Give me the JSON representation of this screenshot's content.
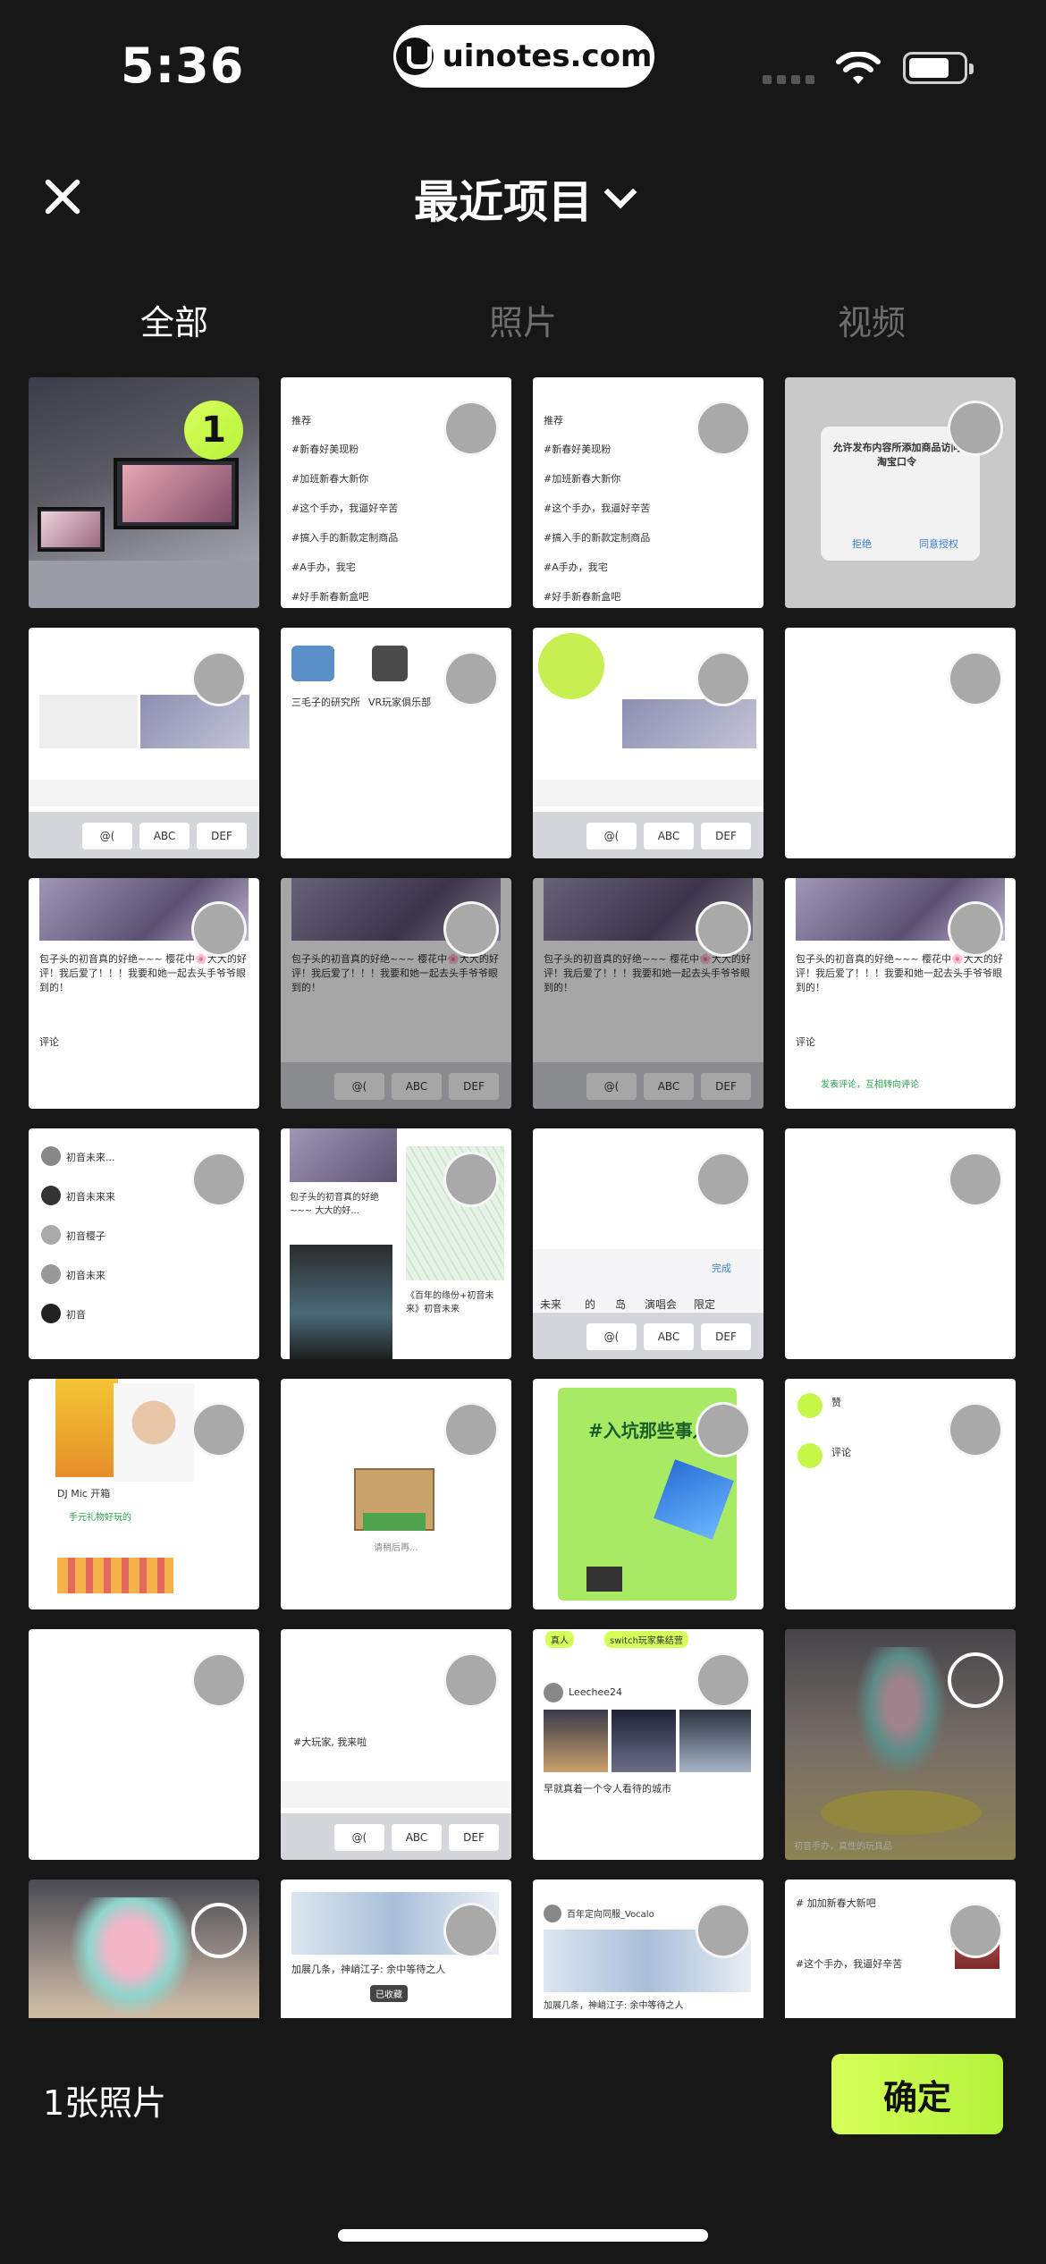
{
  "status_bar": {
    "time": "5:36",
    "url": "uinotes.com"
  },
  "header": {
    "title": "最近项目"
  },
  "tabs": [
    {
      "label": "全部",
      "active": true
    },
    {
      "label": "照片",
      "active": false
    },
    {
      "label": "视频",
      "active": false
    }
  ],
  "grid": {
    "selected_index": "1",
    "thumb_texts": {
      "t2_title": "推荐",
      "t2_lines": [
        "#新春好美现粉",
        "#加班新春大新你",
        "#这个手办，我逼好辛苦",
        "#搞入手的新款定制商品",
        "#A手办，我宅",
        "#好手新春新盒吧"
      ],
      "t4_dialog_title": "允许发布内容所添加商品访问淘宝口令",
      "t4_dialog_btn_left": "拒绝",
      "t4_dialog_btn_right": "同意授权",
      "t6_left": "三毛子的研究所",
      "t6_right": "VR玩家俱乐部",
      "kbd_keys": [
        "@(",
        "ABC",
        "DEF"
      ],
      "t9_caption": "包子头的初音真的好绝~~~ 樱花中🌸大大的好评！我后爱了！！！我要和她一起去头手爷爷眼到的！",
      "t12_comments": "评论",
      "t12_prompt": "发表评论，互相转向评论",
      "t13_users": [
        "初音未来...",
        "初音未来来",
        "初音樱子",
        "初音未来",
        "初音"
      ],
      "t14_caption": "包子头的初音真的好绝~~~ 大大的好...",
      "t14_sub": "《百年的缘份+初音未来》初音未来",
      "t15_suggest": [
        "未来",
        "的",
        "岛",
        "演唱会",
        "限定"
      ],
      "t15_done": "完成",
      "t17_title": "DJ Mic 开箱",
      "t17_tag": "手元礼物好玩的",
      "t18_label": "请稍后再...",
      "t19_title": "#入坑那些事儿",
      "t20_items": [
        "赞",
        "评论"
      ],
      "t22_label": "#大玩家, 我来啦",
      "t23_user": "Leechee24",
      "t23_title": "早就真着一个令人看待的城市",
      "t23_tags": [
        "真人",
        "switch玩家集结营"
      ],
      "t24_caption": "初音手办，真性的玩具品",
      "t26_caption": "加展几条，神峭江子: 余中等待之人",
      "t26_toast": "已收藏",
      "t27_user": "百年定向同服_Vocalo",
      "t27_caption": "加展几条，神峭江子: 余中等待之人",
      "t28_lines": [
        "# 加加新春大新吧",
        "#这个手办，我逼好辛苦"
      ]
    }
  },
  "footer": {
    "count_label": "1张照片",
    "confirm_label": "确定"
  },
  "colors": {
    "accent": "#c6f84a",
    "background": "#171717",
    "unselected_circle": "#a9a9a9"
  }
}
